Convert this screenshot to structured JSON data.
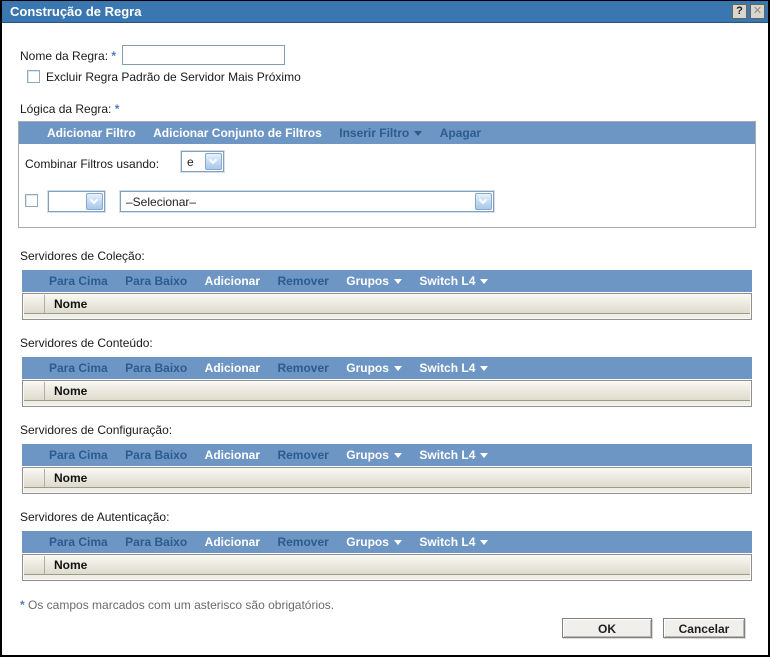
{
  "window": {
    "title": "Construção de Regra",
    "help_label": "?",
    "close_label": "✕"
  },
  "colors": {
    "titlebar_blue": "#3A76AF",
    "toolbar_blue": "#6E96C4",
    "disabled_toolbar_text": "#2C5C8E",
    "asterisk_blue": "#4C7EB5"
  },
  "form": {
    "rule_name_label": "Nome da Regra:",
    "required_mark": "*",
    "rule_name_value": "",
    "exclude_checkbox_label": "Excluir Regra Padrão de Servidor Mais Próximo",
    "rule_logic_label": "Lógica da Regra:"
  },
  "rule_logic": {
    "toolbar": {
      "add_filter": "Adicionar Filtro",
      "add_filter_set": "Adicionar Conjunto de Filtros",
      "insert_filter": "Inserir Filtro",
      "insert_filter_enabled": false,
      "delete": "Apagar",
      "delete_enabled": false
    },
    "combine_label": "Combinar Filtros usando:",
    "combine_value": "e",
    "filter_field_value": "",
    "filter_operator_value": "–Selecionar–"
  },
  "server_toolbar": {
    "up": "Para Cima",
    "up_enabled": false,
    "down": "Para Baixo",
    "down_enabled": false,
    "add": "Adicionar",
    "add_enabled": true,
    "remove": "Remover",
    "remove_enabled": false,
    "groups": "Grupos",
    "groups_enabled": true,
    "switch_l4": "Switch L4",
    "switch_l4_enabled": true
  },
  "table_header": {
    "name": "Nome"
  },
  "sections": [
    {
      "label": "Servidores de Coleção:"
    },
    {
      "label": "Servidores de Conteúdo:"
    },
    {
      "label": "Servidores de Configuração:"
    },
    {
      "label": "Servidores de Autenticação:"
    }
  ],
  "footer": {
    "required_mark": "*",
    "required_note": "Os campos marcados com um asterisco são obrigatórios.",
    "ok": "OK",
    "cancel": "Cancelar"
  }
}
